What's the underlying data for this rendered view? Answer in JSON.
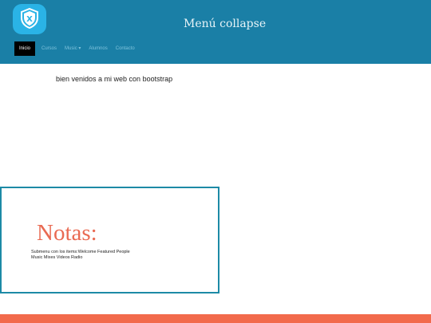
{
  "header": {
    "title": "Menú collapse",
    "logo_icon": "shield-x-icon",
    "background": "#1a7fa6",
    "logo_color": "#2ab3e6"
  },
  "nav": {
    "items": [
      {
        "label": "Inicio",
        "active": true
      },
      {
        "label": "Cursos",
        "active": false
      },
      {
        "label": "Music ▾",
        "active": false
      },
      {
        "label": "Alumnos",
        "active": false
      },
      {
        "label": "Contacto",
        "active": false
      }
    ]
  },
  "main": {
    "welcome": "bien venidos a mi web con bootstrap"
  },
  "notes": {
    "title": "Notas:",
    "text": "Submenu con los items:Welcome Featured People Music Mixes Videos Radio",
    "border_color": "#1d8aa6",
    "title_color": "#e96a52"
  },
  "footer": {
    "color": "#f26a4c"
  }
}
